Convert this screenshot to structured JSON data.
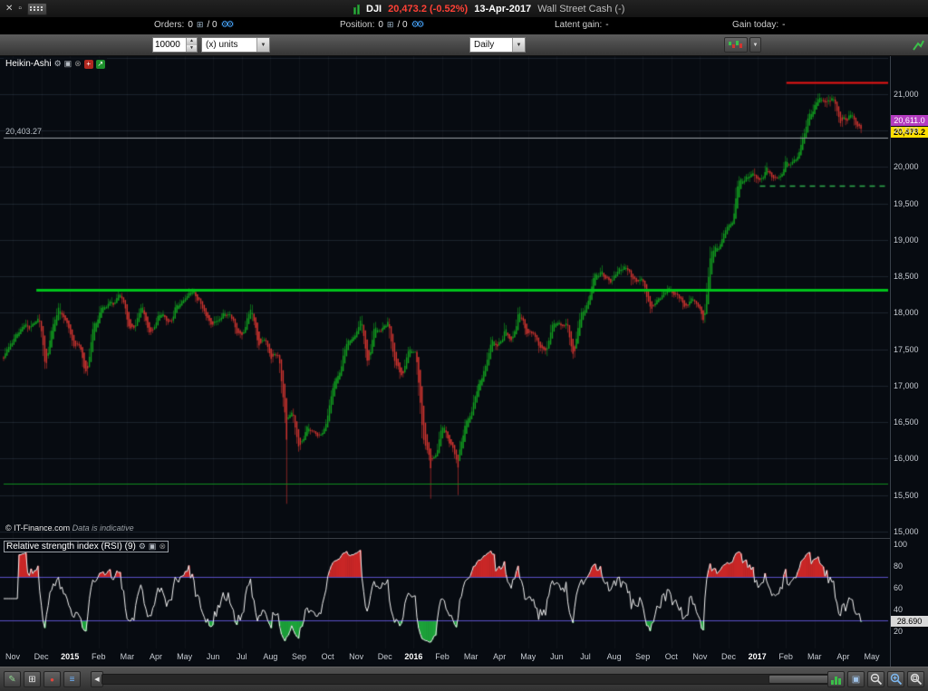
{
  "icons": {
    "close": "✕",
    "restore": "▫",
    "caret_down": "▼",
    "scroll_left": "◀",
    "wrench": "⚙",
    "window": "▣",
    "close_circle": "⊗",
    "grid_small": "⊞",
    "gears": "⚙⚙",
    "pencil": "✎",
    "list": "≡",
    "alert_dot": "●",
    "plus": "+",
    "arrow_up": "↗"
  },
  "title_bar": {
    "instrument": "DJI",
    "last_price": "20,473.2",
    "change": "(-0.52%)",
    "date": "13-Apr-2017",
    "market": "Wall Street Cash (-)"
  },
  "orders_bar": {
    "orders_label": "Orders:",
    "orders_value": "0",
    "orders_suffix": "/ 0",
    "position_label": "Position:",
    "position_value": "0",
    "position_suffix": "/ 0",
    "latent_label": "Latent gain:",
    "latent_value": "-",
    "gain_label": "Gain today:",
    "gain_value": "-"
  },
  "toolbar": {
    "quantity": "10000",
    "units_label": "(x) units",
    "timeframe": "Daily"
  },
  "price_panel": {
    "indicator_label": "Heikin-Ashi",
    "reference_label": "20,403.27",
    "badge_upper": "20,611.0",
    "badge_lower": "20,473.2",
    "watermark": "© IT-Finance.com",
    "watermark_note": " Data is indicative"
  },
  "rsi_panel": {
    "label": "Relative strength index (RSI) (9)",
    "badge": "28.690"
  },
  "time_axis": {
    "labels": [
      {
        "t": "Nov",
        "bold": false
      },
      {
        "t": "Dec",
        "bold": false
      },
      {
        "t": "2015",
        "bold": true
      },
      {
        "t": "Feb",
        "bold": false
      },
      {
        "t": "Mar",
        "bold": false
      },
      {
        "t": "Apr",
        "bold": false
      },
      {
        "t": "May",
        "bold": false
      },
      {
        "t": "Jun",
        "bold": false
      },
      {
        "t": "Jul",
        "bold": false
      },
      {
        "t": "Aug",
        "bold": false
      },
      {
        "t": "Sep",
        "bold": false
      },
      {
        "t": "Oct",
        "bold": false
      },
      {
        "t": "Nov",
        "bold": false
      },
      {
        "t": "Dec",
        "bold": false
      },
      {
        "t": "2016",
        "bold": true
      },
      {
        "t": "Feb",
        "bold": false
      },
      {
        "t": "Mar",
        "bold": false
      },
      {
        "t": "Apr",
        "bold": false
      },
      {
        "t": "May",
        "bold": false
      },
      {
        "t": "Jun",
        "bold": false
      },
      {
        "t": "Jul",
        "bold": false
      },
      {
        "t": "Aug",
        "bold": false
      },
      {
        "t": "Sep",
        "bold": false
      },
      {
        "t": "Oct",
        "bold": false
      },
      {
        "t": "Nov",
        "bold": false
      },
      {
        "t": "Dec",
        "bold": false
      },
      {
        "t": "2017",
        "bold": true
      },
      {
        "t": "Feb",
        "bold": false
      },
      {
        "t": "Mar",
        "bold": false
      },
      {
        "t": "Apr",
        "bold": false
      },
      {
        "t": "May",
        "bold": false
      }
    ]
  },
  "chart_data": {
    "type": "candlestick",
    "style": "Heikin-Ashi",
    "instrument": "DJI Wall Street Cash",
    "timeframe": "Daily",
    "x_range": [
      "Nov-2014",
      "May-2017"
    ],
    "price_axis": {
      "min": 14900,
      "max": 21520,
      "tick_min": 15000,
      "tick_max": 21000,
      "tick_step": 500
    },
    "last_price": 20473.2,
    "weekly_closes": [
      17390,
      17600,
      17690,
      17810,
      17830,
      17960,
      17280,
      17800,
      18050,
      17830,
      17600,
      17510,
      17160,
      17820,
      18020,
      18140,
      18130,
      18290,
      17860,
      17750,
      18130,
      17710,
      17880,
      18060,
      17830,
      18080,
      18190,
      18270,
      18230,
      18010,
      17850,
      17900,
      18010,
      17950,
      17730,
      17730,
      18080,
      17570,
      17690,
      17370,
      17480,
      16460,
      16640,
      16100,
      16430,
      16380,
      16310,
      16470,
      17080,
      17210,
      17650,
      17660,
      17910,
      17250,
      17820,
      17800,
      17850,
      17270,
      17130,
      17550,
      17430,
      16350,
      15990,
      16090,
      16470,
      16200,
      15970,
      16390,
      16640,
      17010,
      17210,
      17600,
      17520,
      17790,
      17580,
      18000,
      17770,
      17740,
      17530,
      17500,
      17870,
      17810,
      17870,
      17400,
      17950,
      18150,
      18520,
      18570,
      18430,
      18540,
      18580,
      18550,
      18400,
      18490,
      18090,
      18120,
      18260,
      18310,
      18240,
      18140,
      18150,
      18160,
      17890,
      18850,
      18870,
      19150,
      19170,
      19760,
      19840,
      19930,
      19760,
      19960,
      19890,
      19830,
      20090,
      20070,
      20270,
      20620,
      20820,
      21000,
      20900,
      20910,
      20600,
      20660,
      20660,
      20453
    ],
    "spike_lows": [
      {
        "week": 41,
        "low": 15380
      },
      {
        "week": 62,
        "low": 15450
      },
      {
        "week": 66,
        "low": 15500
      }
    ],
    "levels": [
      {
        "name": "resistance-red",
        "value": 21155,
        "color": "#ee1515",
        "width": 2,
        "from": 0.885,
        "dash": []
      },
      {
        "name": "gray-reference",
        "value": 20403.27,
        "color": "#9aa0a6",
        "width": 1,
        "from": 0,
        "dash": []
      },
      {
        "name": "dashed-green-target",
        "value": 19750,
        "color": "#2fae4e",
        "width": 1.5,
        "from": 0.855,
        "dash": [
          6,
          5
        ]
      },
      {
        "name": "support-green-major",
        "value": 18310,
        "color": "#00c21b",
        "width": 3,
        "from": 0.037,
        "dash": []
      },
      {
        "name": "support-green-minor",
        "value": 15660,
        "color": "#0f8c1f",
        "width": 1,
        "from": 0,
        "dash": []
      }
    ],
    "rsi": {
      "period": 9,
      "bands": [
        30,
        70
      ],
      "ticks": [
        100,
        80,
        60,
        40,
        20
      ],
      "last": 28.69,
      "range": [
        0,
        100
      ]
    },
    "colors": {
      "up": "#12a11f",
      "down": "#d23530",
      "grid": "#1c242e",
      "vgrid": "rgba(255,255,255,0.035)",
      "bg": "#070b11",
      "rsi_line": "#f2f2f2",
      "rsi_band": "#5a50c8",
      "rsi_over": "rgba(210,40,40,0.95)",
      "rsi_under": "rgba(30,170,60,0.95)"
    }
  }
}
